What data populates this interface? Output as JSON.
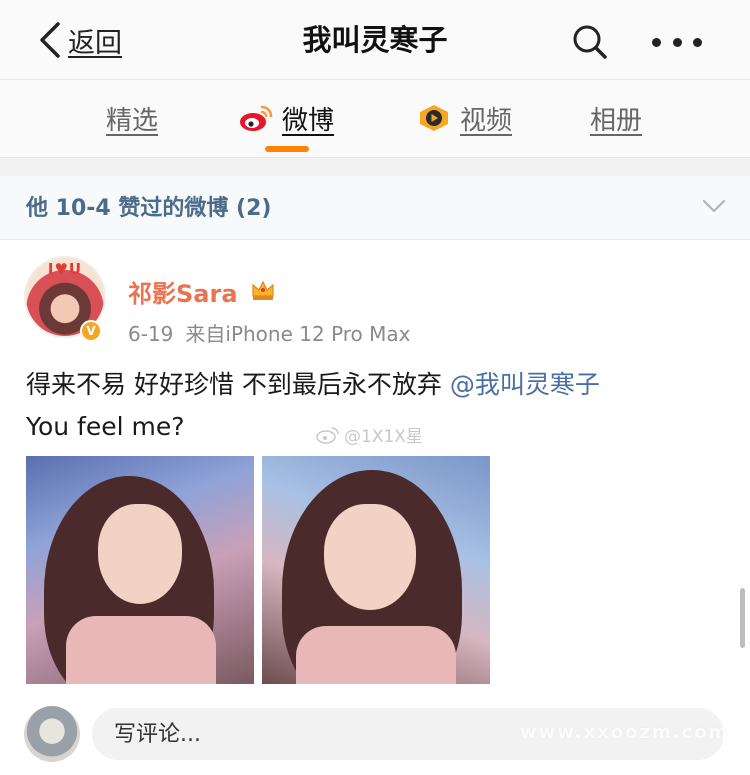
{
  "navbar": {
    "back_label": "返回",
    "title": "我叫灵寒子"
  },
  "tabs": [
    {
      "label": "精选",
      "active": false
    },
    {
      "label": "微博",
      "active": true
    },
    {
      "label": "视频",
      "active": false
    },
    {
      "label": "相册",
      "active": false
    }
  ],
  "section": {
    "title": "他 10-4 赞过的微博 (2)"
  },
  "post": {
    "avatar_text": "I♥U",
    "username": "祁影Sara",
    "date": "6-19",
    "source": "来自iPhone 12 Pro Max",
    "text_line1": "得来不易 好好珍惜 不到最后永不放弃 ",
    "mention": "@我叫灵寒子",
    "text_line2": "You feel me?",
    "image_watermark": "@1X1X星"
  },
  "comment": {
    "placeholder": "写评论...",
    "watermark": "www.xxoozm.com"
  },
  "colors": {
    "accent": "#ff8200",
    "username": "#eb7350",
    "link": "#4a6fa5",
    "section_title": "#4a6b8a"
  }
}
